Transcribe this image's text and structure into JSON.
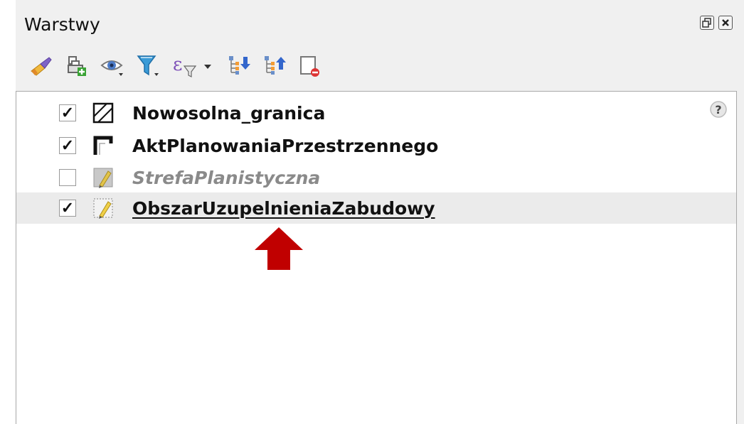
{
  "panel": {
    "title": "Warstwy"
  },
  "title_buttons": [
    {
      "icon": "float-icon"
    },
    {
      "icon": "close-icon"
    }
  ],
  "toolbar": [
    {
      "icon": "style-paint-icon"
    },
    {
      "icon": "add-group-icon"
    },
    {
      "icon": "visibility-eye-icon"
    },
    {
      "icon": "filter-icon"
    },
    {
      "icon": "expression-filter-icon"
    },
    {
      "icon": "expand-all-icon"
    },
    {
      "icon": "collapse-all-icon"
    },
    {
      "icon": "remove-layer-icon"
    }
  ],
  "layers": [
    {
      "name": "Nowosolna_granica",
      "checked": true,
      "icon": "polygon-hatch-icon"
    },
    {
      "name": "AktPlanowaniaPrzestrzennego",
      "checked": true,
      "icon": "polygon-outline-icon"
    },
    {
      "name": "StrefaPlanistyczna",
      "checked": false,
      "icon": "polygon-pencil-icon"
    },
    {
      "name": "ObszarUzupelnieniaZabudowy",
      "checked": true,
      "icon": "polygon-pencil-icon"
    }
  ],
  "check_mark": "✓",
  "annotation": {
    "icon": "red-arrow-up-icon",
    "color": "#c00000"
  }
}
